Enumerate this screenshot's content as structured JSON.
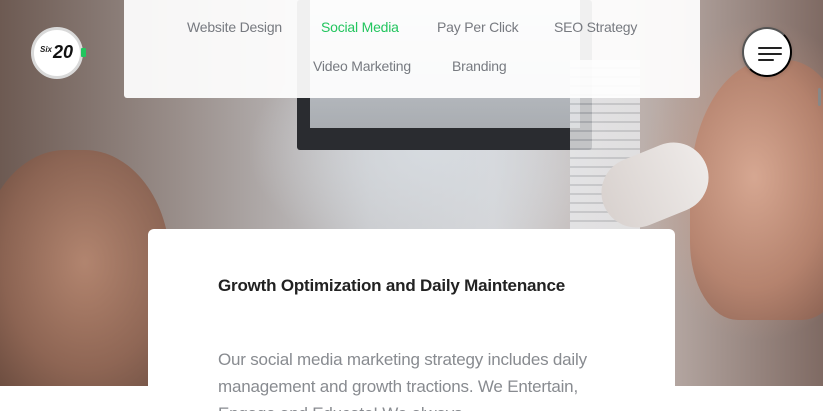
{
  "logo": {
    "prefix": "Six",
    "number": "20",
    "accent_color": "#22c55e"
  },
  "nav": {
    "items": [
      {
        "label": "Website Design",
        "active": false
      },
      {
        "label": "Social Media",
        "active": true
      },
      {
        "label": "Pay Per Click",
        "active": false
      },
      {
        "label": "SEO Strategy",
        "active": false
      },
      {
        "label": "Video Marketing",
        "active": false
      },
      {
        "label": "Branding",
        "active": false
      }
    ],
    "active_color": "#22c55e",
    "inactive_color": "#777a80"
  },
  "menu_button": {
    "icon": "hamburger-menu-icon"
  },
  "card": {
    "title": "Growth Optimization and Daily Maintenance",
    "body": "Our social media marketing strategy includes daily management and growth tractions. We Entertain, Engage and Educate! We always"
  }
}
